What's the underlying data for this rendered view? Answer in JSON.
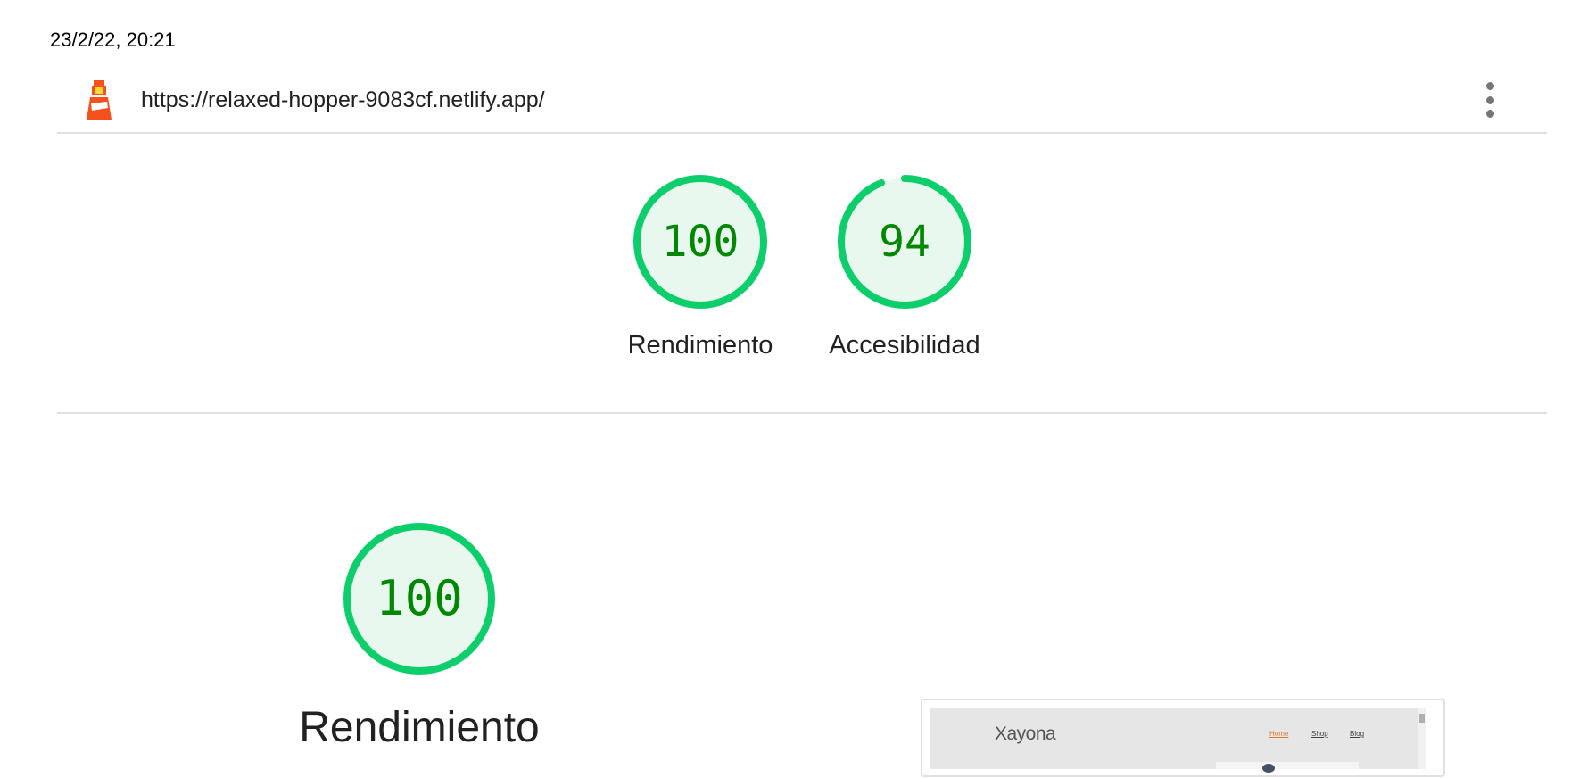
{
  "timestamp": "23/2/22, 20:21",
  "header": {
    "url": "https://relaxed-hopper-9083cf.netlify.app/",
    "logo_icon": "lighthouse-icon",
    "menu_icon": "kebab-menu-icon"
  },
  "colors": {
    "pass_stroke": "#0cce6b",
    "pass_fill": "#e8f8ee",
    "pass_text": "#008800",
    "track": "#e0e0e0"
  },
  "gauges": [
    {
      "score": 100,
      "label": "Rendimiento"
    },
    {
      "score": 94,
      "label": "Accesibilidad"
    }
  ],
  "category": {
    "score": 100,
    "title": "Rendimiento"
  },
  "final_screenshot": {
    "brand": "Xayona",
    "nav": [
      "Home",
      "Shop",
      "Blog"
    ]
  }
}
